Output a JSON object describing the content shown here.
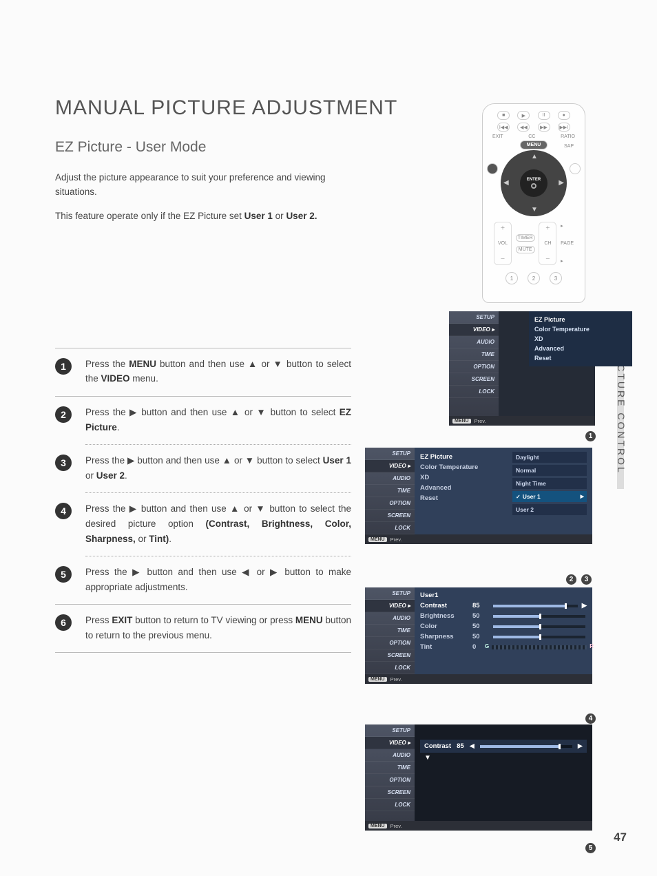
{
  "title": "MANUAL PICTURE ADJUSTMENT",
  "subtitle": "EZ Picture - User Mode",
  "intro1": "Adjust the picture appearance to suit your preference and viewing situations.",
  "intro2_a": "This feature operate only if the EZ Picture set ",
  "intro2_b": "User 1",
  "intro2_c": " or ",
  "intro2_d": "User 2.",
  "side_tab": "PICTURE CONTROL",
  "page_number": "47",
  "steps": [
    {
      "n": "1",
      "pre": "Press the ",
      "b1": "MENU",
      "mid1": " button and then use ▲ or ▼ button to select the ",
      "b2": "VIDEO",
      "post": " menu."
    },
    {
      "n": "2",
      "pre": "Press the ▶ button and then use ▲ or ▼ button to select ",
      "b1": "EZ Picture",
      "post": "."
    },
    {
      "n": "3",
      "pre": "Press the ▶ button and then use ▲ or ▼ button to select ",
      "b1": "User 1",
      "mid1": " or ",
      "b2": "User 2",
      "post": "."
    },
    {
      "n": "4",
      "pre": "Press the ▶ button and then use ▲ or ▼ button to select the desired picture option ",
      "b1": "(Contrast, Brightness, Color, Sharpness,",
      "mid1": " or ",
      "b2": "Tint)",
      "post": "."
    },
    {
      "n": "5",
      "pre": "Press the ▶ button and then use ◀ or ▶ button to make appropriate adjustments.",
      "b1": "",
      "post": ""
    },
    {
      "n": "6",
      "pre": "Press ",
      "b1": "EXIT",
      "mid1": " button to return to TV viewing or press ",
      "b2": "MENU",
      "post": " button to return to the previous menu."
    }
  ],
  "remote": {
    "menu": "MENU",
    "exit": "EXIT",
    "cc": "CC",
    "ratio": "RATIO",
    "sap": "SAP",
    "enter": "ENTER",
    "vol": "VOL",
    "ch": "CH",
    "page": "PAGE",
    "timer": "TIMER",
    "mute": "MUTE",
    "nums": [
      "1",
      "2",
      "3"
    ],
    "topA": [
      "■",
      "▶",
      "II",
      "●"
    ],
    "topB": [
      "I◀◀",
      "◀◀",
      "▶▶",
      "▶▶I"
    ]
  },
  "sidebar_items": [
    "SETUP",
    "VIDEO",
    "AUDIO",
    "TIME",
    "OPTION",
    "SCREEN",
    "LOCK"
  ],
  "prev_label": "Prev.",
  "osd1": {
    "sel": "VIDEO",
    "panel": [
      "EZ Picture",
      "Color Temperature",
      "XD",
      "Advanced",
      "Reset"
    ]
  },
  "osd2": {
    "sel": "VIDEO",
    "colA": [
      {
        "t": "EZ Picture",
        "sel": true
      },
      {
        "t": "Color Temperature"
      },
      {
        "t": "XD"
      },
      {
        "t": "Advanced"
      },
      {
        "t": "Reset"
      }
    ],
    "colB": [
      {
        "t": "Daylight"
      },
      {
        "t": "Normal"
      },
      {
        "t": "Night Time"
      },
      {
        "t": "User 1",
        "sel": true,
        "chk": true
      },
      {
        "t": "User 2"
      }
    ]
  },
  "osd3": {
    "sel": "VIDEO",
    "head": "User1",
    "rows": [
      {
        "t": "Contrast",
        "v": "85",
        "pct": 85,
        "sel": true
      },
      {
        "t": "Brightness",
        "v": "50",
        "pct": 50
      },
      {
        "t": "Color",
        "v": "50",
        "pct": 50
      },
      {
        "t": "Sharpness",
        "v": "50",
        "pct": 50
      },
      {
        "t": "Tint",
        "v": "0",
        "tint": true
      }
    ]
  },
  "osd4": {
    "sel": "VIDEO",
    "strip": {
      "t": "Contrast",
      "v": "85",
      "pct": 85
    }
  },
  "callouts": {
    "c1": "1",
    "c2": "2",
    "c3": "3",
    "c4": "4",
    "c5": "5"
  }
}
